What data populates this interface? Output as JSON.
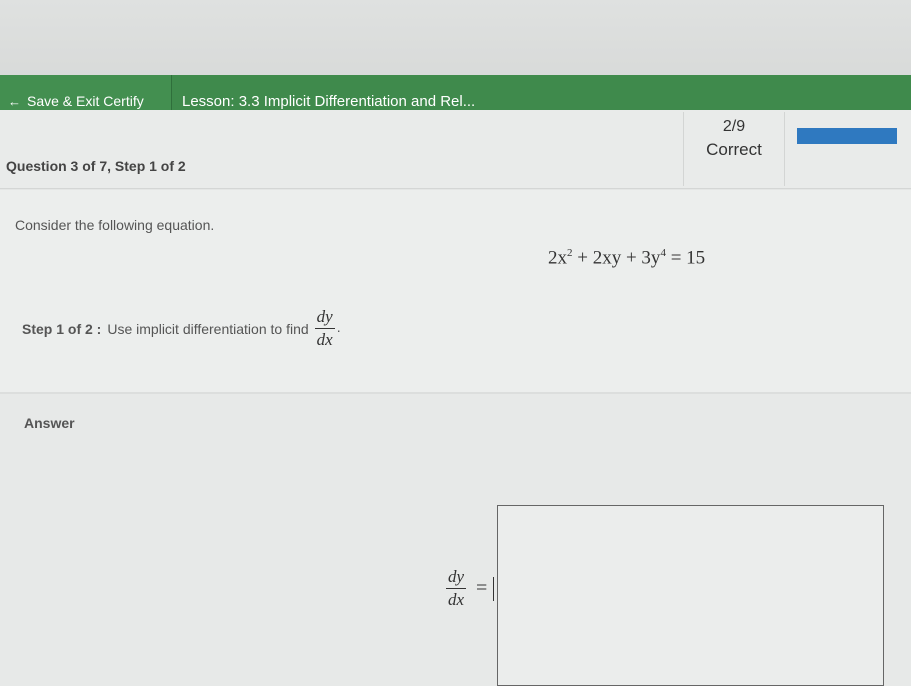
{
  "header": {
    "save_exit_label": "Save & Exit Certify",
    "arrow_glyph": "←",
    "lesson_title": "Lesson: 3.3 Implicit Differentiation and Rel..."
  },
  "status": {
    "question_label": "Question 3 of 7, Step 1 of 2",
    "score_fraction": "2/9",
    "score_status": "Correct",
    "progress_fraction": 1.0
  },
  "content": {
    "intro": "Consider the following equation.",
    "equation": {
      "a_coef": "2x",
      "a_exp": "2",
      "b_term": " + 2xy + 3y",
      "b_exp": "4",
      "rhs": " = 15"
    },
    "step_label": "Step 1 of 2 :",
    "step_text": "Use implicit differentiation to find",
    "deriv_num": "dy",
    "deriv_den": "dx",
    "period": "."
  },
  "answer": {
    "label": "Answer",
    "lhs_num": "dy",
    "lhs_den": "dx",
    "equals": "=",
    "value": ""
  },
  "colors": {
    "header_green": "#3f8a4c",
    "progress_blue": "#2f79c0"
  }
}
